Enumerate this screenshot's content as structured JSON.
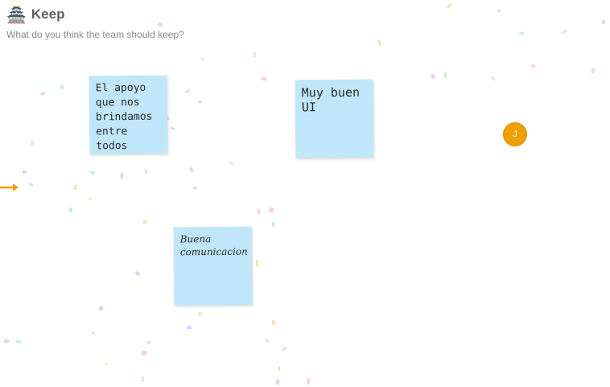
{
  "header": {
    "icon": "pagoda-icon",
    "title": "Keep",
    "subtitle": "What do you think the team should keep?"
  },
  "notes": [
    {
      "text": "El apoyo que nos brindamos entre todos"
    },
    {
      "text": "Muy buen UI"
    },
    {
      "text": "Buena comunicacion"
    }
  ],
  "participants": [
    {
      "initial": "J",
      "color": "#f0a000"
    }
  ],
  "colors": {
    "note": "#c0e6f9",
    "arrow": "#f0a000"
  }
}
